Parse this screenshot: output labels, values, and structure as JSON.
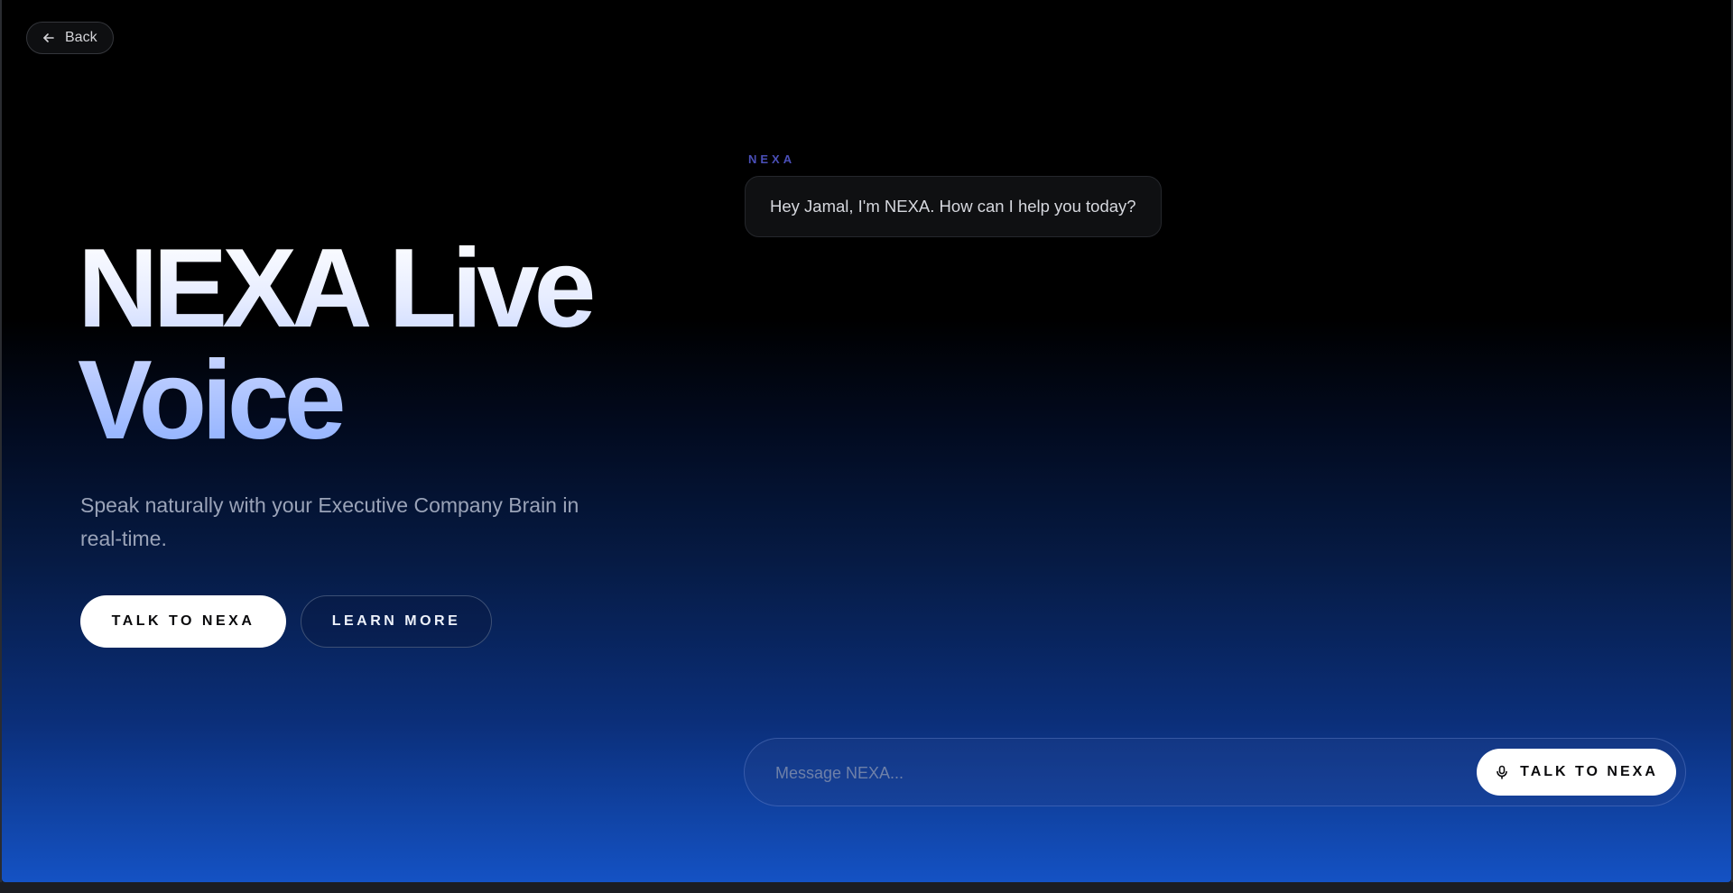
{
  "nav": {
    "back_label": "Back",
    "back_icon": "arrow-left-icon"
  },
  "hero": {
    "title_line1": "NEXA Live",
    "title_line2": "Voice",
    "subtitle": "Speak naturally with your Executive Company Brain in real-time.",
    "primary_button": "TALK TO NEXA",
    "secondary_button": "LEARN MORE"
  },
  "chat": {
    "messages": [
      {
        "sender": "NEXA",
        "text": "Hey Jamal, I'm NEXA. How can I help you today?"
      }
    ]
  },
  "composer": {
    "placeholder": "Message NEXA...",
    "value": "",
    "talk_button": "TALK TO NEXA",
    "talk_icon": "microphone-icon"
  },
  "colors": {
    "background_top": "#000000",
    "background_bottom": "#1452c4",
    "sender_label": "#4a4fb8",
    "button_primary_bg": "#ffffff"
  }
}
